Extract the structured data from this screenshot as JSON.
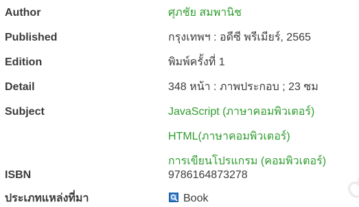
{
  "record": {
    "author": {
      "label": "Author",
      "value": "ศุภชัย สมพานิช"
    },
    "published": {
      "label": "Published",
      "value": "กรุงเทพฯ : อดีซี พรีเมียร์, 2565"
    },
    "edition": {
      "label": "Edition",
      "value": "พิมพ์ครั้งที่ 1"
    },
    "detail": {
      "label": "Detail",
      "value": "348 หน้า : ภาพประกอบ ; 23 ซม"
    },
    "subject": {
      "label": "Subject",
      "items": [
        "JavaScript (ภาษาคอมพิวเตอร์)",
        "HTML(ภาษาคอมพิวเตอร์)",
        "การเขียนโปรแกรม (คอมพิวเตอร์)"
      ]
    },
    "isbn": {
      "label": "ISBN",
      "value": "9786164873278"
    },
    "resource_type": {
      "label": "ประเภทแหล่งที่มา",
      "value": "Book",
      "icon": "book-icon"
    }
  },
  "colors": {
    "link": "#2e9c2e",
    "label": "#3a3a3a",
    "text": "#3a3a3a"
  }
}
